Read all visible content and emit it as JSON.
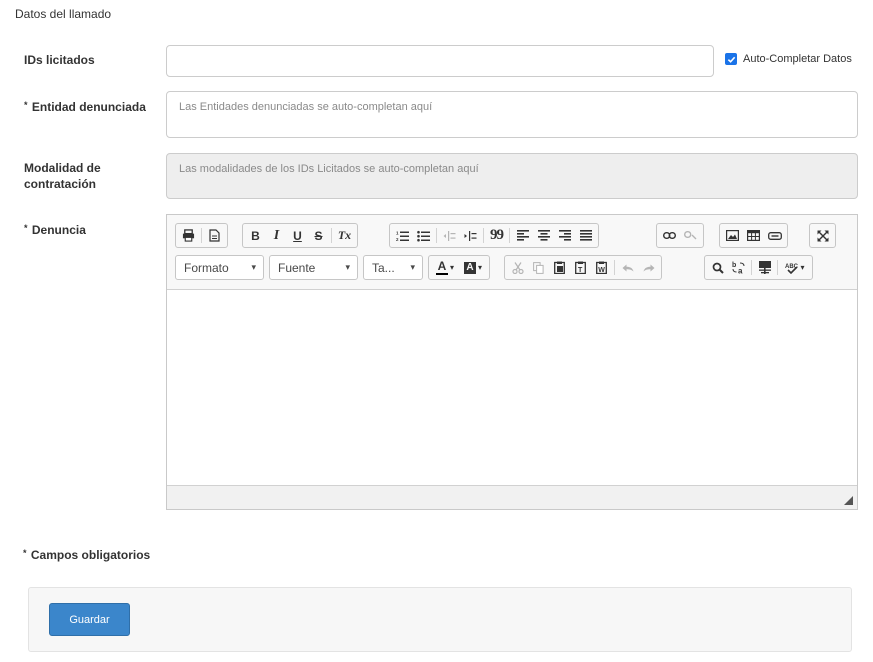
{
  "section": {
    "title": "Datos del llamado"
  },
  "form": {
    "ids": {
      "label": "IDs licitados",
      "value": ""
    },
    "autocomplete": {
      "label": "Auto-Completar Datos",
      "checked": true
    },
    "entidad": {
      "required": "*",
      "label": "Entidad denunciada",
      "placeholder": "Las Entidades denunciadas se auto-completan aquí"
    },
    "modalidad": {
      "label": "Modalidad de contratación",
      "placeholder": "Las modalidades de los IDs Licitados se auto-completan aquí"
    },
    "denuncia": {
      "required": "*",
      "label": "Denuncia"
    }
  },
  "editor": {
    "format_combo": "Formato",
    "font_combo": "Fuente",
    "size_combo": "Ta...",
    "glyphs": {
      "bold": "B",
      "italic": "I",
      "underline": "U",
      "strike": "S",
      "remove_format": "Tx",
      "blockquote": "99",
      "font_color": "A",
      "bg_color": "A",
      "arrow": "▾"
    }
  },
  "footer": {
    "required_note_star": "*",
    "required_note": "Campos obligatorios",
    "save_label": "Guardar"
  },
  "colors": {
    "accent": "#3b86cb",
    "checkbox": "#1a73e8",
    "readonly_bg": "#eeeeee"
  },
  "icons": [
    "print-icon",
    "preview-icon",
    "bold-icon",
    "italic-icon",
    "underline-icon",
    "strikethrough-icon",
    "remove-format-icon",
    "numbered-list-icon",
    "bulleted-list-icon",
    "outdent-icon",
    "indent-icon",
    "blockquote-icon",
    "align-left-icon",
    "align-center-icon",
    "align-right-icon",
    "align-justify-icon",
    "link-icon",
    "unlink-icon",
    "image-icon",
    "table-icon",
    "embed-icon",
    "maximize-icon",
    "cut-icon",
    "copy-icon",
    "paste-icon",
    "paste-text-icon",
    "paste-word-icon",
    "undo-icon",
    "redo-icon",
    "find-icon",
    "replace-icon",
    "select-all-icon",
    "spellcheck-icon",
    "resize-icon",
    "check-icon"
  ]
}
